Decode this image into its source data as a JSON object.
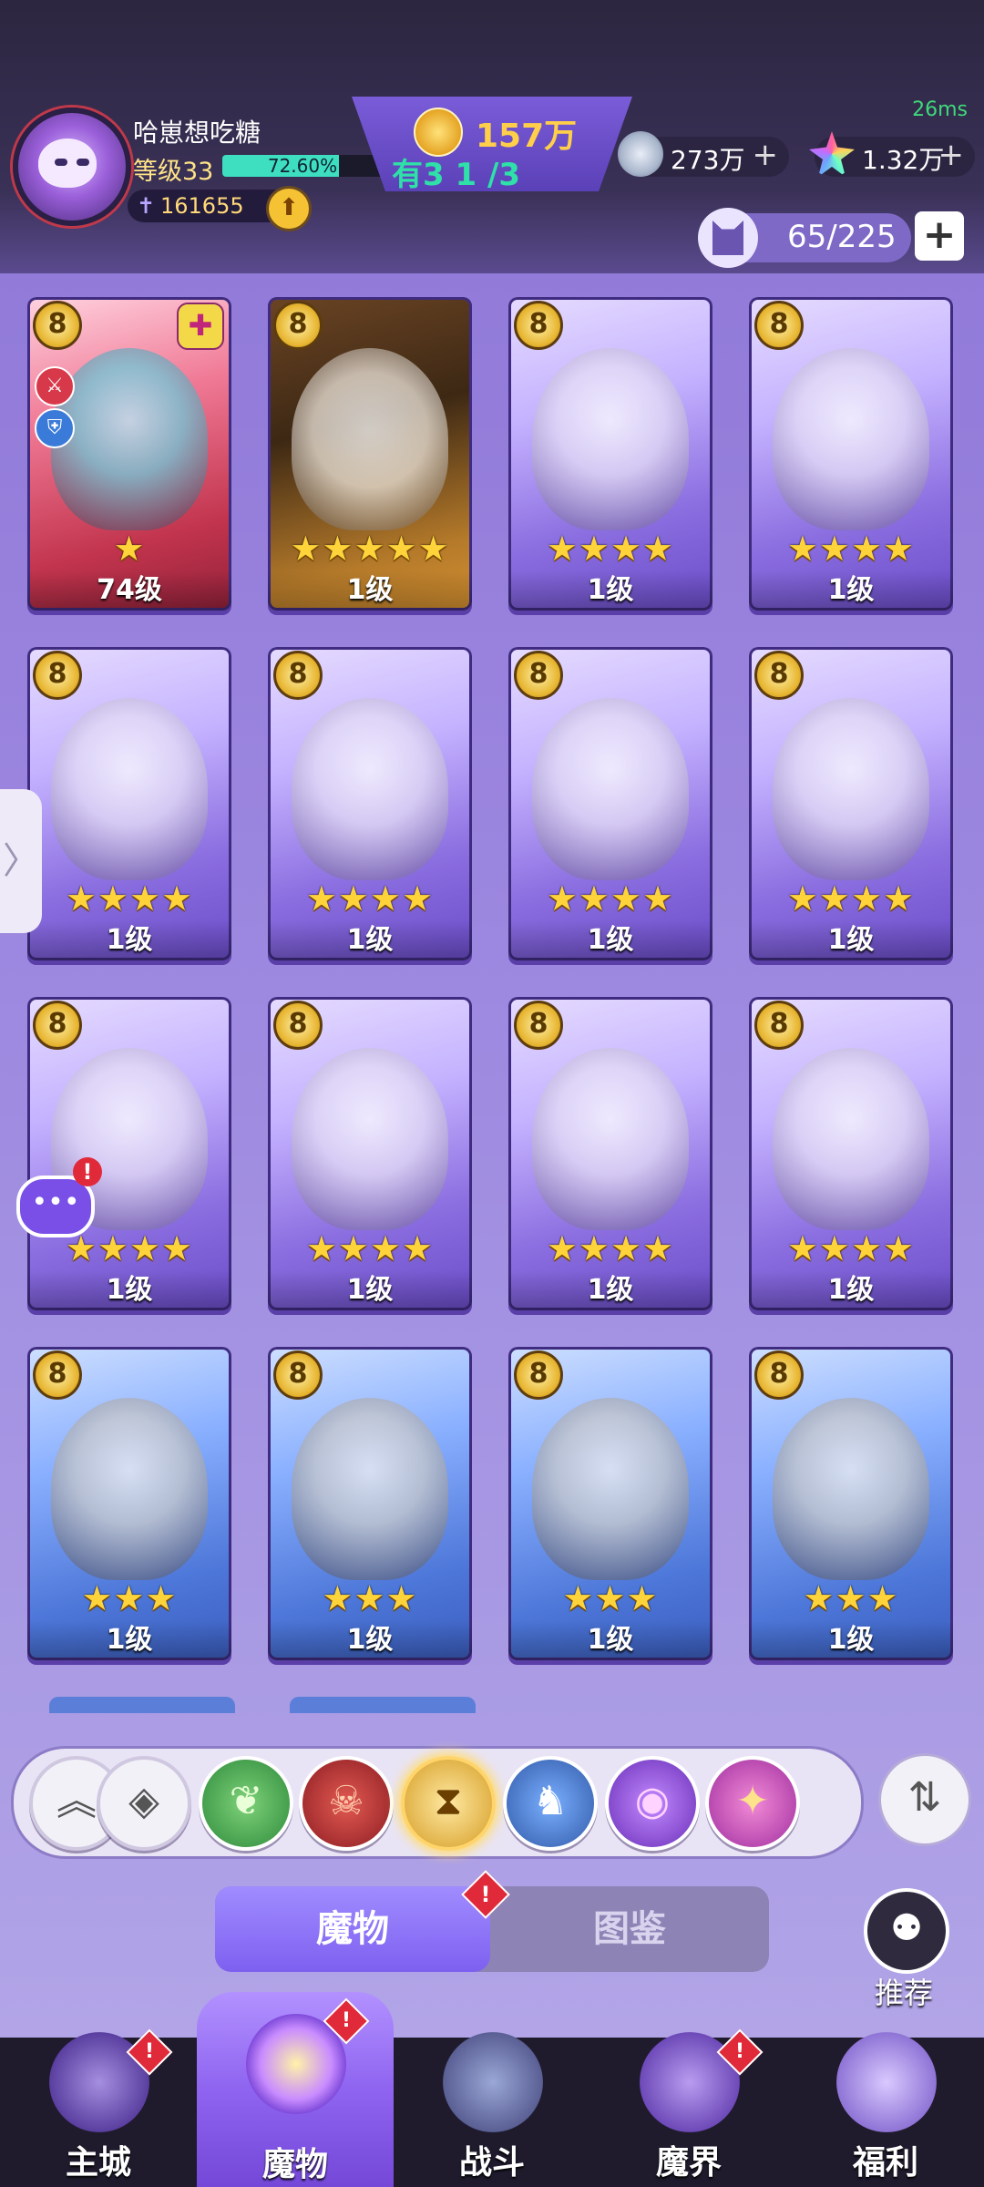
{
  "header": {
    "ping": "26ms",
    "player_name": "哈崽想吃糖",
    "level_text": "等级33",
    "xp_percent": "72.60%",
    "xp_fraction": 0.726,
    "power": "161655",
    "gold": "157万",
    "gold_overlay": "有3 1 /3 ",
    "silver": "273万",
    "gems": "1.32万",
    "capacity": "65/225"
  },
  "cards": [
    {
      "level": "74级",
      "stars": "★",
      "color": "red"
    },
    {
      "level": "1级",
      "stars": "★★★★★",
      "color": "orange"
    },
    {
      "level": "1级",
      "stars": "★★★★",
      "color": "purple"
    },
    {
      "level": "1级",
      "stars": "★★★★",
      "color": "purple"
    },
    {
      "level": "1级",
      "stars": "★★★★",
      "color": "purple"
    },
    {
      "level": "1级",
      "stars": "★★★★",
      "color": "purple"
    },
    {
      "level": "1级",
      "stars": "★★★★",
      "color": "purple"
    },
    {
      "level": "1级",
      "stars": "★★★★",
      "color": "purple"
    },
    {
      "level": "1级",
      "stars": "★★★★",
      "color": "purple"
    },
    {
      "level": "1级",
      "stars": "★★★★",
      "color": "purple"
    },
    {
      "level": "1级",
      "stars": "★★★★",
      "color": "purple"
    },
    {
      "level": "1级",
      "stars": "★★★★",
      "color": "purple"
    },
    {
      "level": "1级",
      "stars": "★★★",
      "color": "blue"
    },
    {
      "level": "1级",
      "stars": "★★★",
      "color": "blue"
    },
    {
      "level": "1级",
      "stars": "★★★",
      "color": "blue"
    },
    {
      "level": "1级",
      "stars": "★★★",
      "color": "blue"
    }
  ],
  "icons": {
    "badge": "8",
    "star": "★",
    "plus": "+",
    "sword": "✝",
    "up": "⬆",
    "handle": "〉",
    "chat": "•••",
    "alert": "!",
    "sort": "⇅",
    "recommend": "⚉",
    "item": "✚",
    "side_attack": "⚔",
    "side_shield": "⛨"
  },
  "filters": [
    {
      "name": "filter-all-rarity",
      "glyph": "︽",
      "style": "plain"
    },
    {
      "name": "filter-all-types",
      "glyph": "◈",
      "style": "plain"
    },
    {
      "name": "filter-nature",
      "glyph": "❦",
      "style": "green"
    },
    {
      "name": "filter-demon",
      "glyph": "☠",
      "style": "red"
    },
    {
      "name": "filter-time",
      "glyph": "⧗",
      "style": "gold"
    },
    {
      "name": "filter-dragon",
      "glyph": "♞",
      "style": "steel"
    },
    {
      "name": "filter-eye",
      "glyph": "◉",
      "style": "violet"
    },
    {
      "name": "filter-star",
      "glyph": "✦",
      "style": "pink"
    }
  ],
  "tabs": {
    "monsters": "魔物",
    "codex": "图鉴"
  },
  "recommend_label": "推荐",
  "nav": [
    {
      "label": "主城",
      "dot": true,
      "icon": "castle"
    },
    {
      "label": "魔物",
      "dot": true,
      "icon": "monster",
      "active": true
    },
    {
      "label": "战斗",
      "dot": false,
      "icon": "battle"
    },
    {
      "label": "魔界",
      "dot": true,
      "icon": "realm"
    },
    {
      "label": "福利",
      "dot": false,
      "icon": "welfare"
    }
  ]
}
